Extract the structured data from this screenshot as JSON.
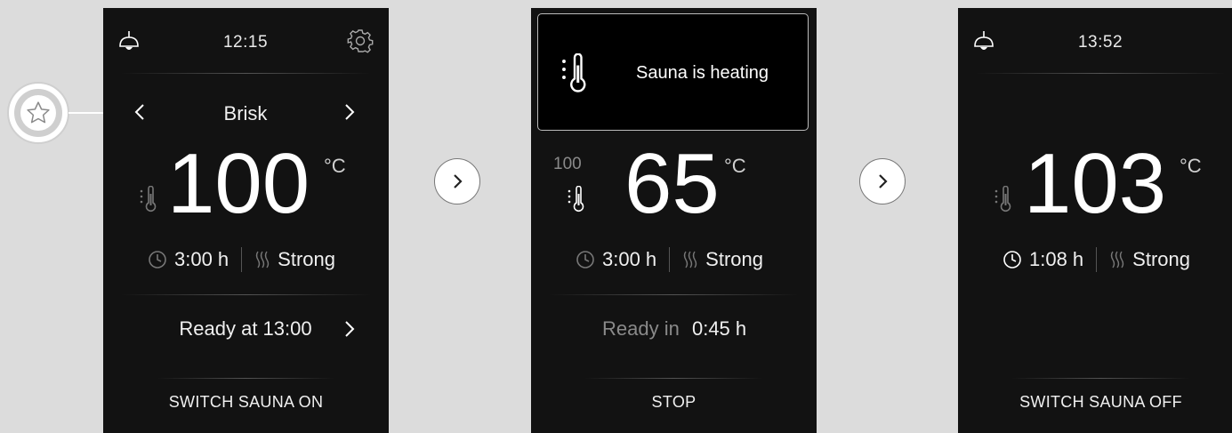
{
  "screens": {
    "setup": {
      "time": "12:15",
      "profile": "Brisk",
      "temperature": "100",
      "unit": "°C",
      "duration": "3:00 h",
      "humidity": "Strong",
      "ready_text": "Ready at 13:00",
      "action": "SWITCH SAUNA ON"
    },
    "heating": {
      "notification": "Sauna is heating",
      "target_temperature": "100",
      "temperature": "65",
      "unit": "°C",
      "duration": "3:00 h",
      "humidity": "Strong",
      "ready_label": "Ready in",
      "ready_value": "0:45 h",
      "action": "STOP"
    },
    "running": {
      "time": "13:52",
      "temperature": "103",
      "unit": "°C",
      "duration": "1:08 h",
      "humidity": "Strong",
      "action": "SWITCH SAUNA OFF"
    }
  },
  "icons": {
    "light": "lamp-icon",
    "settings": "gear-icon",
    "favorite": "star-icon",
    "thermometer": "thermometer-icon",
    "timer": "clock-icon",
    "humidity": "steam-icon",
    "next": "chevron-right-icon",
    "previous": "chevron-left-icon"
  },
  "colors": {
    "screen_background": "#121212",
    "page_background": "#dcdcdc",
    "text": "#ffffff",
    "dim_text": "#8a8a8a"
  }
}
